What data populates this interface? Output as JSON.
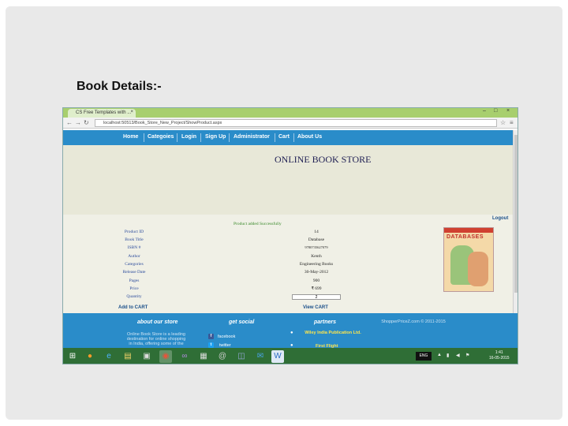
{
  "slide": {
    "title": "Book Details:-"
  },
  "browser": {
    "tab_title": "CS Free Templates with ...",
    "tab_close": "×",
    "url": "localhost:50513/Book_Store_New_Project/ShowProduct.aspx",
    "window_controls": [
      "–",
      "□",
      "×"
    ]
  },
  "menu": {
    "items": [
      "Home",
      "Categoies",
      "Login",
      "Sign Up",
      "Administrator",
      "Cart",
      "About Us"
    ]
  },
  "header": {
    "store_title": "ONLINE BOOK STORE"
  },
  "content": {
    "logout": "Logout",
    "success_message": "Product added Successfully",
    "fields": [
      {
        "label": "Product ID",
        "value": "14"
      },
      {
        "label": "Book Title",
        "value": "Database"
      },
      {
        "label": "ISBN #",
        "value": "9780735627079"
      },
      {
        "label": "Author",
        "value": "Kenth"
      },
      {
        "label": "Categories",
        "value": "Engineering Books"
      },
      {
        "label": "Release Date",
        "value": "30-May-2012"
      },
      {
        "label": "Pages",
        "value": "900"
      },
      {
        "label": "Price",
        "value": "₹ 699"
      },
      {
        "label": "Quantity",
        "value": "2"
      }
    ],
    "add_to_cart": "Add to CART",
    "view_cart": "View CART",
    "cover_title": "DATABASES"
  },
  "footer": {
    "about_heading": "about our store",
    "about_text": [
      "Online Book Store is a leading",
      "destination for online shopping",
      "in India, offering some of the"
    ],
    "social_heading": "get social",
    "social": [
      {
        "name": "facebook",
        "icon": "f"
      },
      {
        "name": "twitter",
        "icon": "t"
      }
    ],
    "partners_heading": "partners",
    "partners": [
      "Wiley India Publication Ltd.",
      "First Flight"
    ],
    "copyright": "ShopperPriceZ.com © 2011-2015"
  },
  "taskbar": {
    "apps": [
      "windows",
      "firefox",
      "ie",
      "explorer",
      "media",
      "chrome",
      "vs",
      "photos",
      "settings",
      "vmware",
      "outlook",
      "word"
    ],
    "language": "ENG",
    "time": "1:41",
    "date": "16-05-2015"
  },
  "colors": {
    "menu_bar": "#2a8cc9",
    "tab_bar": "#a8cf6e",
    "taskbar": "#2f6e36",
    "partner_link": "#ffe64a"
  }
}
